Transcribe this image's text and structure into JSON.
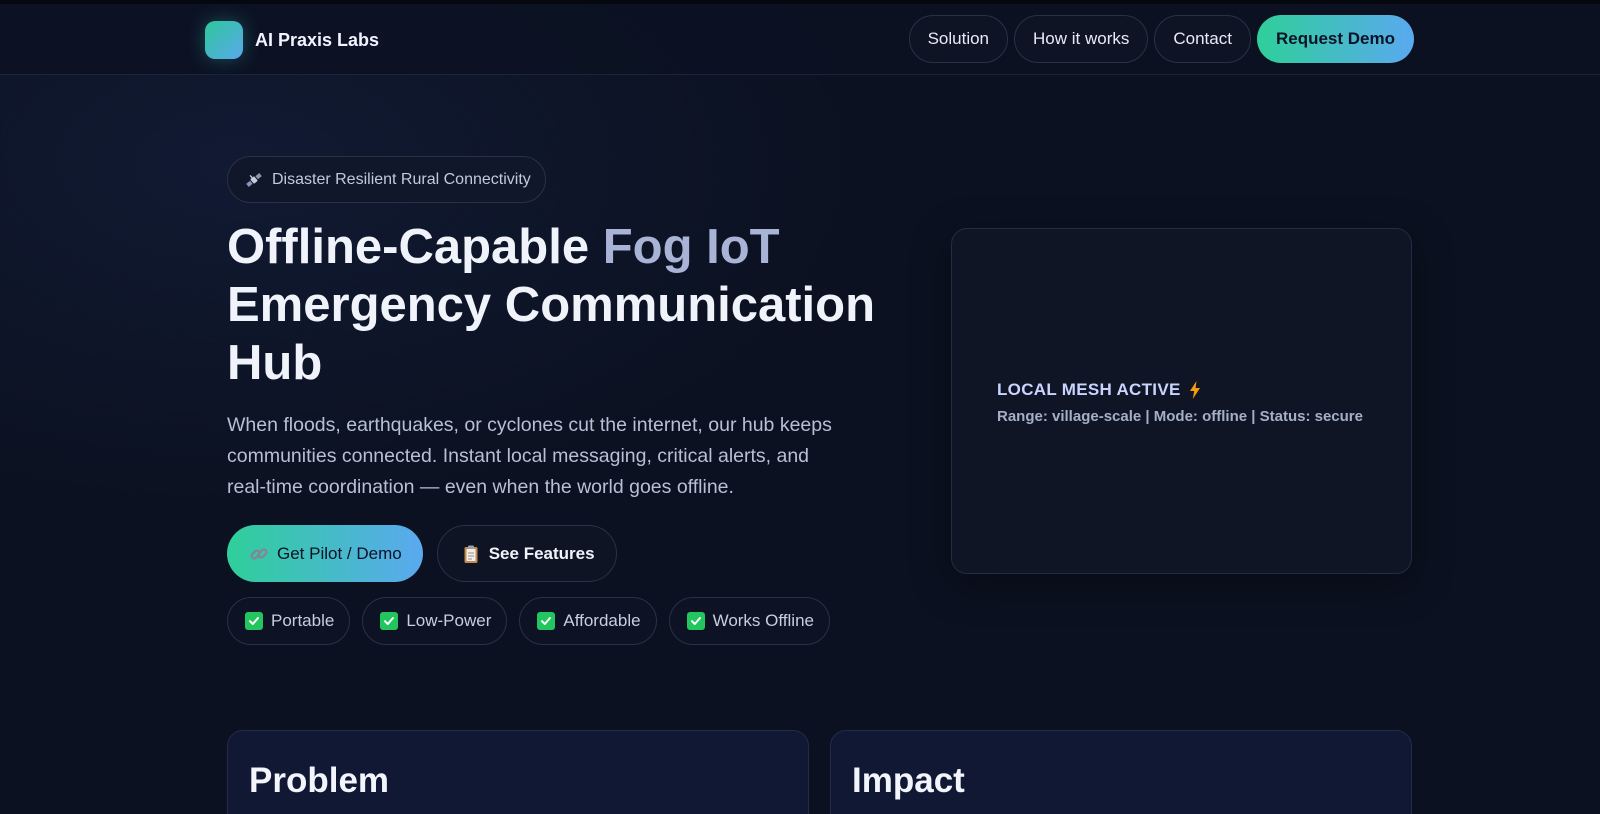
{
  "nav": {
    "brand": "AI Praxis Labs",
    "links": [
      "Solution",
      "How it works",
      "Contact"
    ],
    "cta": "Request Demo"
  },
  "hero": {
    "badge_icon": "satellite-icon",
    "badge": "Disaster Resilient Rural Connectivity",
    "title_part1": "Offline-Capable ",
    "title_accent": "Fog IoT",
    "title_part2": "Emergency Communication Hub",
    "lede": "When floods, earthquakes, or cyclones cut the internet, our hub keeps communities connected. Instant local messaging, critical alerts, and real-time coordination — even when the world goes offline.",
    "primary_cta": "Get Pilot / Demo",
    "primary_cta_icon": "link-icon",
    "secondary_cta": "See Features",
    "secondary_cta_icon": "clipboard-icon",
    "features": [
      "Portable",
      "Low-Power",
      "Affordable",
      "Works Offline"
    ]
  },
  "status_card": {
    "title": "LOCAL MESH ACTIVE",
    "title_icon": "lightning-icon",
    "detail": "Range: village-scale | Mode: offline | Status: secure"
  },
  "panels": {
    "problem_title": "Problem",
    "impact_title": "Impact"
  },
  "colors": {
    "background": "#0b1120",
    "accent_gradient_start": "#2fcf9a",
    "accent_gradient_end": "#5aa9ef",
    "check_green": "#22c55e",
    "bolt_orange": "#f59e0b"
  }
}
